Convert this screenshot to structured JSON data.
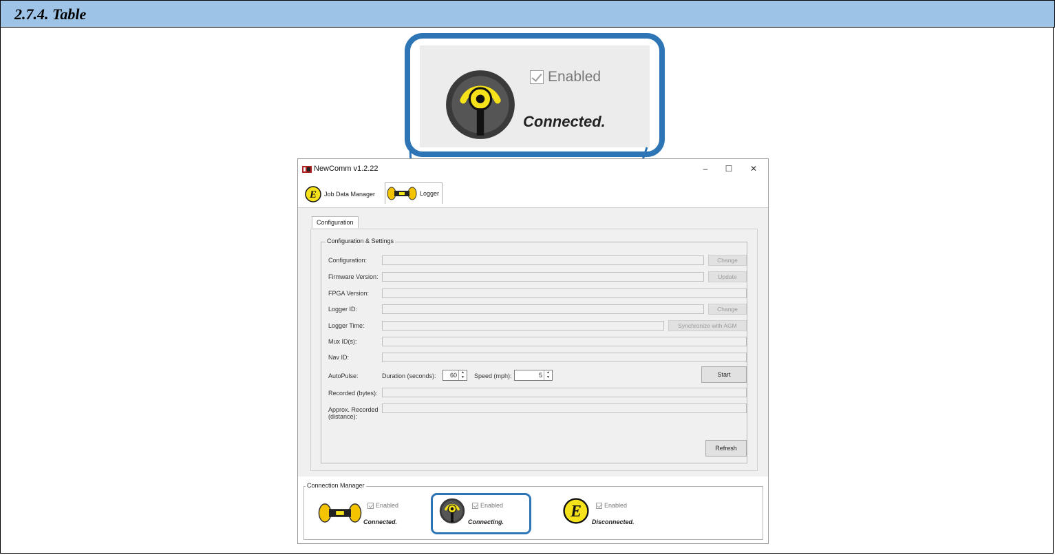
{
  "section": {
    "title": "2.7.4. Table"
  },
  "callout": {
    "enabled_label": "Enabled",
    "status": "Connected."
  },
  "window": {
    "title": "NewComm v1.2.22",
    "minimize": "–",
    "maximize": "☐",
    "close": "✕"
  },
  "tabs": {
    "job_data_manager": "Job Data Manager",
    "logger": "Logger"
  },
  "subtab": {
    "label": "Configuration"
  },
  "group": {
    "legend": "Configuration & Settings",
    "configuration_label": "Configuration:",
    "configuration_button": "Change",
    "firmware_label": "Firmware Version:",
    "firmware_button": "Update",
    "fpga_label": "FPGA Version:",
    "logger_id_label": "Logger ID:",
    "logger_id_button": "Change",
    "logger_time_label": "Logger Time:",
    "logger_time_button": "Synchronize with AGM",
    "mux_label": "Mux ID(s):",
    "nav_label": "Nav ID:",
    "autopulse_label": "AutoPulse:",
    "duration_label": "Duration (seconds):",
    "duration_value": "60",
    "speed_label": "Speed (mph):",
    "speed_value": "5",
    "start_button": "Start",
    "recorded_label": "Recorded (bytes):",
    "approx_label_1": "Approx. Recorded",
    "approx_label_2": "(distance):",
    "refresh_button": "Refresh"
  },
  "connection_manager": {
    "legend": "Connection Manager",
    "logger": {
      "enabled_label": "Enabled",
      "status": "Connected."
    },
    "nav": {
      "enabled_label": "Enabled",
      "status": "Connecting."
    },
    "jdm": {
      "enabled_label": "Enabled",
      "status": "Disconnected."
    }
  },
  "colors": {
    "accent": "#2e75b6",
    "header_bar": "#9dc3e6",
    "icon_yellow": "#f5e21a"
  }
}
